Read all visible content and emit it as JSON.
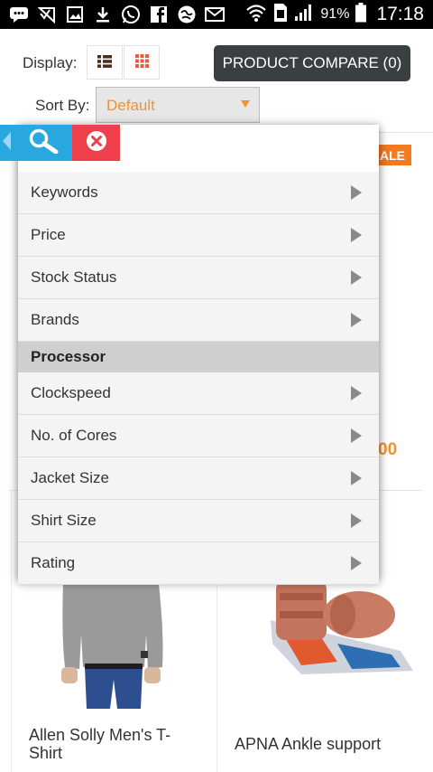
{
  "status_bar": {
    "icons": [
      "chat-icon",
      "signal-check-icon",
      "image-icon",
      "download-icon",
      "whatsapp-icon",
      "facebook-icon",
      "browser-icon",
      "mail-icon",
      "wifi-icon",
      "sim-icon",
      "signal-bars-icon",
      "battery-icon"
    ],
    "battery": "91%",
    "time": "17:18"
  },
  "toolbar": {
    "display_label": "Display:",
    "list_view_icon": "list-view-icon",
    "grid_view_icon": "grid-view-icon",
    "compare_label": "PRODUCT COMPARE (0)",
    "sort_label": "Sort By:",
    "sort_value": "Default"
  },
  "filter": {
    "header_icons": [
      "back-arrow-icon",
      "search-icon",
      "close-icon"
    ],
    "items": [
      {
        "label": "Keywords",
        "type": "item"
      },
      {
        "label": "Price",
        "type": "item"
      },
      {
        "label": "Stock Status",
        "type": "item"
      },
      {
        "label": "Brands",
        "type": "item"
      },
      {
        "label": "Processor",
        "type": "group"
      },
      {
        "label": "Clockspeed",
        "type": "item"
      },
      {
        "label": "No. of Cores",
        "type": "item"
      },
      {
        "label": "Jacket Size",
        "type": "item"
      },
      {
        "label": "Shirt Size",
        "type": "item"
      },
      {
        "label": "Rating",
        "type": "item"
      }
    ]
  },
  "background": {
    "sale_badge": "ALE",
    "price_fragment": "00",
    "products": [
      {
        "name": "Allen Solly Men's T-Shirt"
      },
      {
        "name": "APNA Ankle support"
      }
    ]
  },
  "colors": {
    "accent_orange": "#f0932b",
    "filter_blue": "#29a8e0",
    "close_red": "#ef3f4a",
    "compare_dark": "#3a3f41"
  }
}
